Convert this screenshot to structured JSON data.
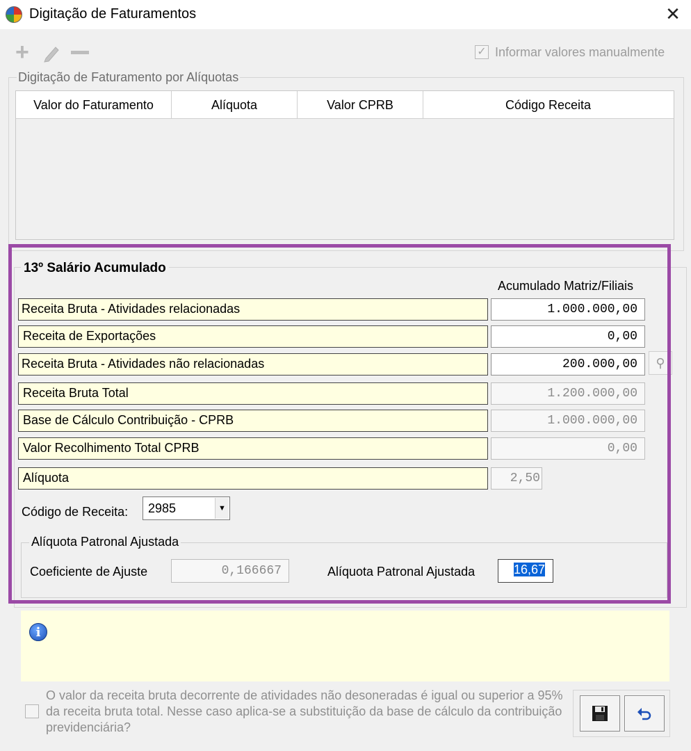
{
  "window": {
    "title": "Digitação de Faturamentos",
    "close_glyph": "✕"
  },
  "toolbar": {
    "add_icon": "plus-icon",
    "edit_icon": "pencil-icon",
    "remove_icon": "minus-icon",
    "manual_checkbox_label": "Informar valores manualmente",
    "manual_checked": true
  },
  "aliquotas_group": {
    "title": "Digitação de Faturamento por Alíquotas",
    "columns": [
      "Valor do Faturamento",
      "Alíquota",
      "Valor CPRB",
      "Código Receita"
    ],
    "rows": []
  },
  "section13": {
    "title": "13º Salário Acumulado",
    "column_caption": "Acumulado Matriz/Filiais",
    "rows": [
      {
        "label": "Receita Bruta - Atividades relacionadas",
        "value": "1.000.000,00"
      },
      {
        "label": "Receita de Exportações",
        "value": "0,00"
      },
      {
        "label": "Receita Bruta - Atividades não relacionadas",
        "value": "200.000,00"
      },
      {
        "label": "Receita Bruta Total",
        "value": "1.200.000,00"
      },
      {
        "label": "Base de Cálculo Contribuição - CPRB",
        "value": "1.000.000,00"
      },
      {
        "label": "Valor Recolhimento Total CPRB",
        "value": "0,00"
      },
      {
        "label": "Alíquota",
        "value": "2,50"
      }
    ],
    "codigo_receita_label": "Código de Receita:",
    "codigo_receita_value": "2985",
    "patronal": {
      "title": "Alíquota Patronal Ajustada",
      "coef_label": "Coeficiente de Ajuste",
      "coef_value": "0,166667",
      "aliquota_label": "Alíquota Patronal Ajustada",
      "aliquota_value": "16,67"
    }
  },
  "info": {
    "icon": "info-icon"
  },
  "footer": {
    "checkbox_text": "O valor da receita bruta decorrente de atividades não desoneradas é igual ou superior a 95% da receita bruta total. Nesse caso aplica-se a substituição da base de cálculo da contribuição previdenciária?",
    "save_icon": "save-icon",
    "undo_icon": "undo-icon"
  },
  "colors": {
    "highlight": "#9b4aa6",
    "label_bg": "#ffffe1",
    "selection": "#0a64d8"
  }
}
